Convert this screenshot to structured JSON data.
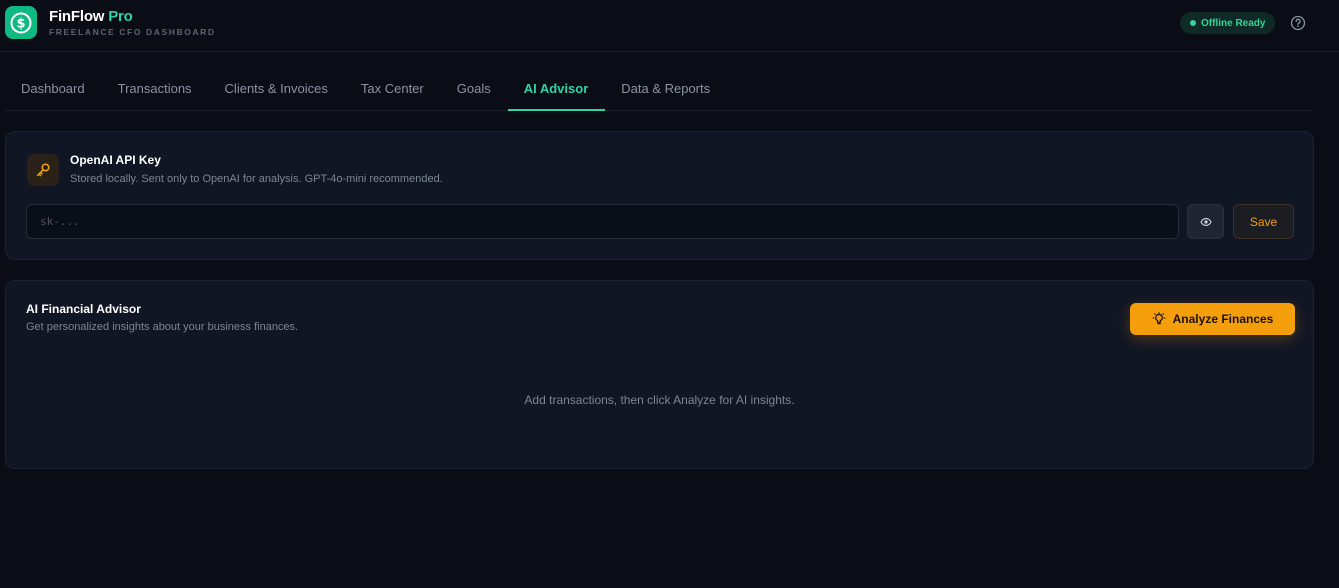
{
  "app": {
    "name": "FinFlow",
    "name_accent": "Pro",
    "subtitle": "FREELANCE CFO DASHBOARD",
    "status": "Offline Ready",
    "brand_color": "#10b981",
    "accent_color": "#2dd4a8",
    "warning_color": "#f59e0b"
  },
  "nav": {
    "tabs": [
      {
        "label": "Dashboard",
        "active": false
      },
      {
        "label": "Transactions",
        "active": false
      },
      {
        "label": "Clients & Invoices",
        "active": false
      },
      {
        "label": "Tax Center",
        "active": false
      },
      {
        "label": "Goals",
        "active": false
      },
      {
        "label": "AI Advisor",
        "active": true
      },
      {
        "label": "Data & Reports",
        "active": false
      }
    ]
  },
  "api_key": {
    "title": "OpenAI API Key",
    "description": "Stored locally. Sent only to OpenAI for analysis. GPT-4o-mini recommended.",
    "input_value": "",
    "placeholder": "sk-...",
    "save_label": "Save",
    "icon": "key-icon"
  },
  "advisor": {
    "title": "AI Financial Advisor",
    "description": "Get personalized insights about your business finances.",
    "analyze_label": "Analyze Finances",
    "empty_message": "Add transactions, then click Analyze for AI insights.",
    "icon": "lightbulb-icon"
  }
}
